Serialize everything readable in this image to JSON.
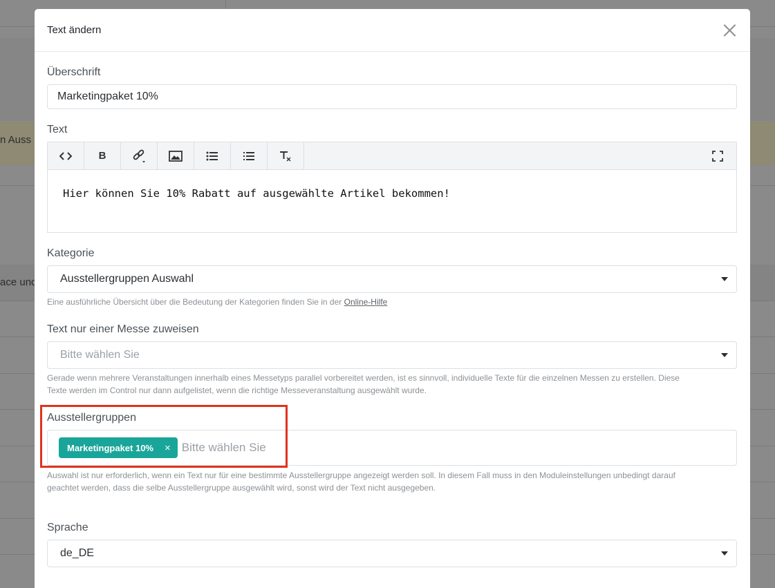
{
  "background": {
    "fragment_1": "n Auss",
    "fragment_2": "ace und"
  },
  "modal": {
    "title": "Text ändern",
    "fields": {
      "heading": {
        "label": "Überschrift",
        "value": "Marketingpaket 10%"
      },
      "text": {
        "label": "Text",
        "content": "Hier können Sie 10% Rabatt auf ausgewählte Artikel bekommen!",
        "toolbar": {
          "code_icon": "code-icon",
          "bold_label": "B",
          "link_icon": "link-icon",
          "image_icon": "image-icon",
          "unordered_list_icon": "unordered-list-icon",
          "ordered_list_icon": "ordered-list-icon",
          "clear_format_icon": "clear-format-icon",
          "fullscreen_icon": "fullscreen-icon"
        }
      },
      "category": {
        "label": "Kategorie",
        "value": "Ausstellergruppen Auswahl",
        "help_text": "Eine ausführliche Übersicht über die Bedeutung der Kategorien finden Sie in der",
        "help_link": "Online-Hilfe"
      },
      "fair": {
        "label": "Text nur einer Messe zuweisen",
        "placeholder": "Bitte wählen Sie",
        "help_line_1": "Gerade wenn mehrere Veranstaltungen innerhalb eines Messetyps parallel vorbereitet werden, ist es sinnvoll, individuelle Texte für die einzelnen Messen zu erstellen. Diese",
        "help_line_2": "Texte werden im Control nur dann aufgelistet, wenn die richtige Messeveranstaltung ausgewählt wurde."
      },
      "exhibitor_groups": {
        "label": "Ausstellergruppen",
        "tag": "Marketingpaket 10%",
        "tag_remove": "×",
        "placeholder": "Bitte wählen Sie",
        "help_line_1": "Auswahl ist nur erforderlich, wenn ein Text nur für eine bestimmte Ausstellergruppe angezeigt werden soll. In diesem Fall muss in den Moduleinstellungen unbedingt darauf",
        "help_line_2": "geachtet werden, dass die selbe Ausstellergruppe ausgewählt wird, sonst wird der Text nicht ausgegeben."
      },
      "language": {
        "label": "Sprache",
        "value": "de_DE"
      }
    }
  },
  "colors": {
    "tag_background": "#1aa59a",
    "highlight_border": "#e1321d"
  }
}
